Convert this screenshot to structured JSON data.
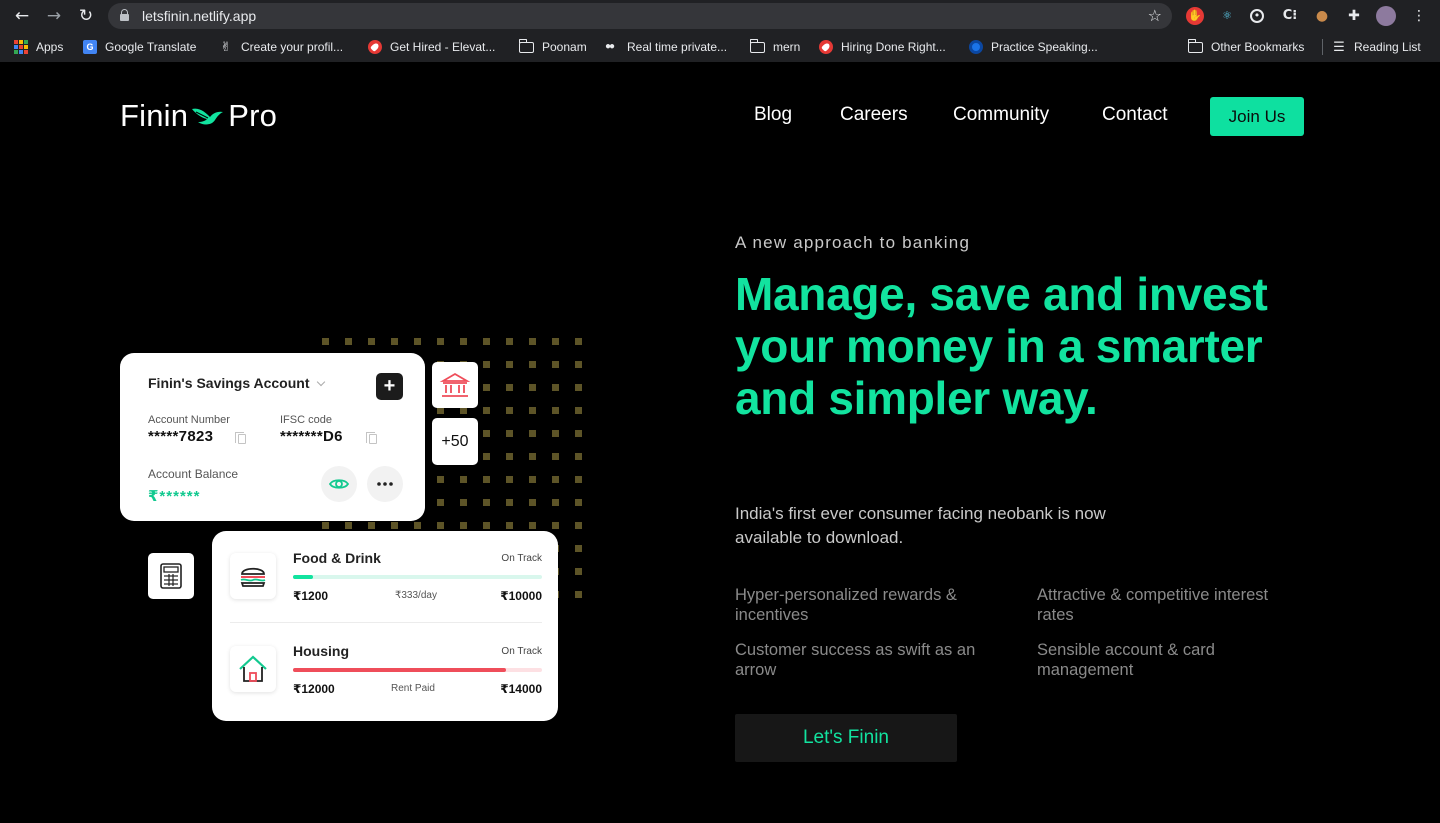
{
  "browser": {
    "url": "letsfinin.netlify.app",
    "bookmarks": [
      {
        "label": "Apps",
        "icon": "apps-grid-icon"
      },
      {
        "label": "Google Translate",
        "icon": "google-translate-icon"
      },
      {
        "label": "Create your profil...",
        "icon": "peace-hand-icon"
      },
      {
        "label": "Get Hired - Elevat...",
        "icon": "rocket-icon"
      },
      {
        "label": "Poonam",
        "icon": "folder-icon"
      },
      {
        "label": "Real time private...",
        "icon": "medium-icon"
      },
      {
        "label": "mern",
        "icon": "folder-icon"
      },
      {
        "label": "Hiring Done Right...",
        "icon": "rocket-icon"
      },
      {
        "label": "Practice Speaking...",
        "icon": "globe-icon"
      },
      {
        "label": "Other Bookmarks",
        "icon": "folder-icon"
      },
      {
        "label": "Reading List",
        "icon": "reading-list-icon"
      }
    ]
  },
  "site": {
    "logo_left": "Finin",
    "logo_right": "Pro",
    "nav": [
      "Blog",
      "Careers",
      "Community",
      "Contact"
    ],
    "join": "Join Us"
  },
  "hero": {
    "eyebrow": "A new approach to banking",
    "headline": "Manage, save and invest your money in a smarter and simpler way.",
    "subtext": "India's first ever consumer facing neobank is now available to download.",
    "features": [
      "Hyper-personalized rewards & incentives",
      "Attractive & competitive interest rates",
      "Customer success as swift as an arrow",
      "Sensible account & card management"
    ],
    "cta": "Let's Finin"
  },
  "account_card": {
    "title": "Finin's Savings Account",
    "account_number_label": "Account Number",
    "account_number": "*****7823",
    "ifsc_label": "IFSC code",
    "ifsc": "*******D6",
    "balance_label": "Account Balance",
    "balance": "₹******",
    "counter": "+50"
  },
  "budgets": [
    {
      "name": "Food & Drink",
      "status": "On Track",
      "spent": "₹1200",
      "middle": "₹333/day",
      "limit": "₹10000",
      "progress": 0.08,
      "color": "#12e39f",
      "track_color": "#d9f7ed"
    },
    {
      "name": "Housing",
      "status": "On Track",
      "spent": "₹12000",
      "middle": "Rent Paid",
      "limit": "₹14000",
      "progress": 0.857,
      "color": "#ef4d5a",
      "track_color": "#fde0e3"
    }
  ],
  "colors": {
    "accent": "#12e39f",
    "background": "#000000"
  }
}
